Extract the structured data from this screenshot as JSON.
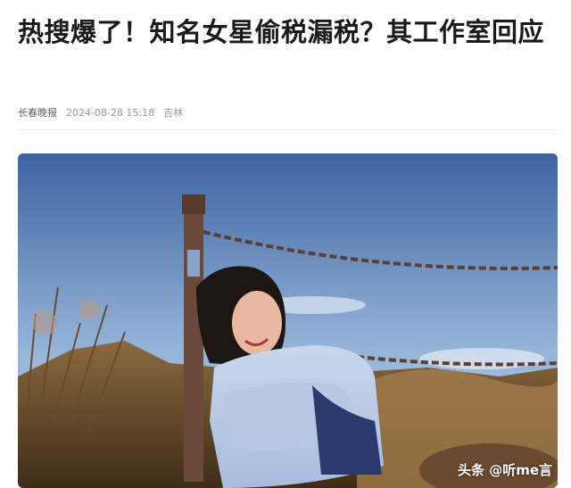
{
  "article": {
    "title": "热搜爆了！知名女星偷税漏税？其工作室回应",
    "source": "长春晚报",
    "datetime": "2024-08-28 15:18",
    "location": "吉林"
  },
  "image": {
    "watermark": "头条 @听me言"
  },
  "colors": {
    "title": "#1a1a1a",
    "meta": "#999999",
    "sky_top": "#4a6fa8",
    "sky_bottom": "#b9cde3",
    "hill": "#7a5a34"
  }
}
